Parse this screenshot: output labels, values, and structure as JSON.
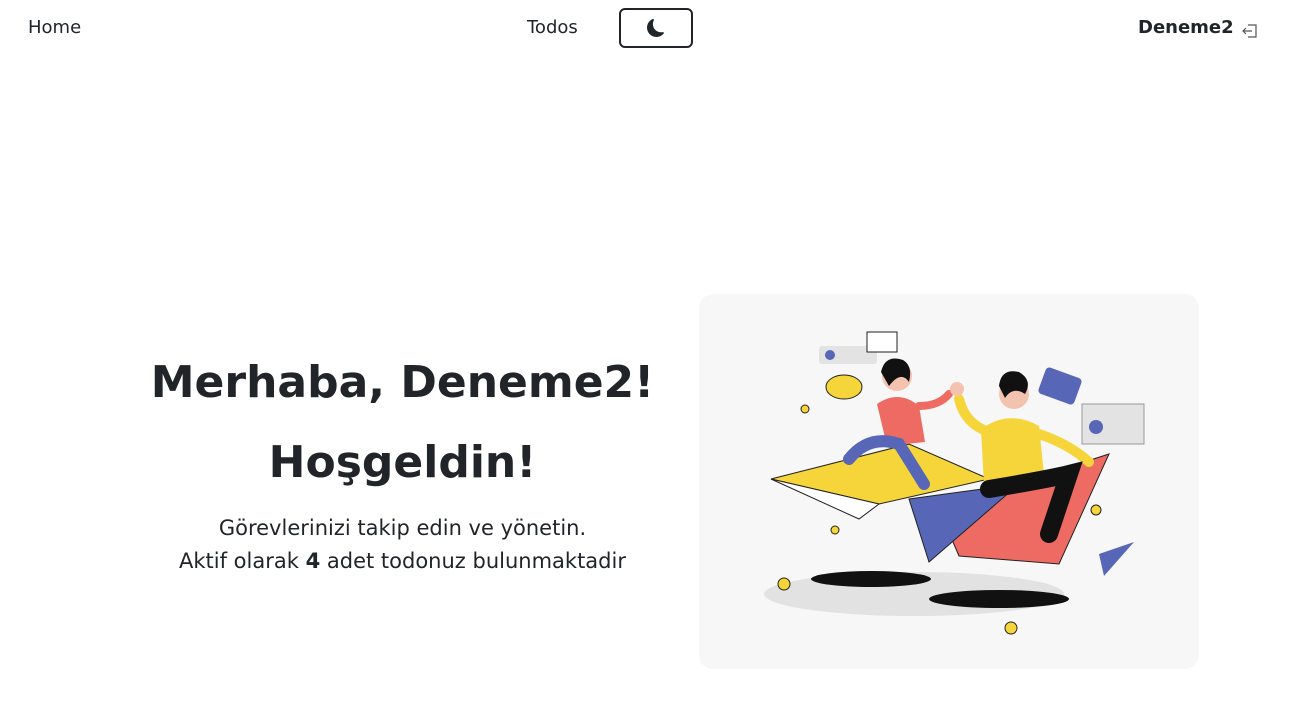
{
  "navbar": {
    "home_label": "Home",
    "todos_label": "Todos",
    "theme_toggle_icon": "moon-icon",
    "username": "Deneme2",
    "logout_icon": "logout-icon"
  },
  "hero": {
    "greeting": "Merhaba, Deneme2!",
    "welcome": "Hoşgeldin!",
    "subtitle": "Görevlerinizi takip edin ve yönetin.",
    "active_prefix": "Aktif olarak",
    "active_count": "4",
    "active_suffix": "adet todonuz bulunmaktadir"
  },
  "colors": {
    "text": "#212529",
    "card_bg": "#f7f7f7",
    "illus_yellow": "#f5d53a",
    "illus_coral": "#ee6b63",
    "illus_blue": "#5866b7"
  }
}
